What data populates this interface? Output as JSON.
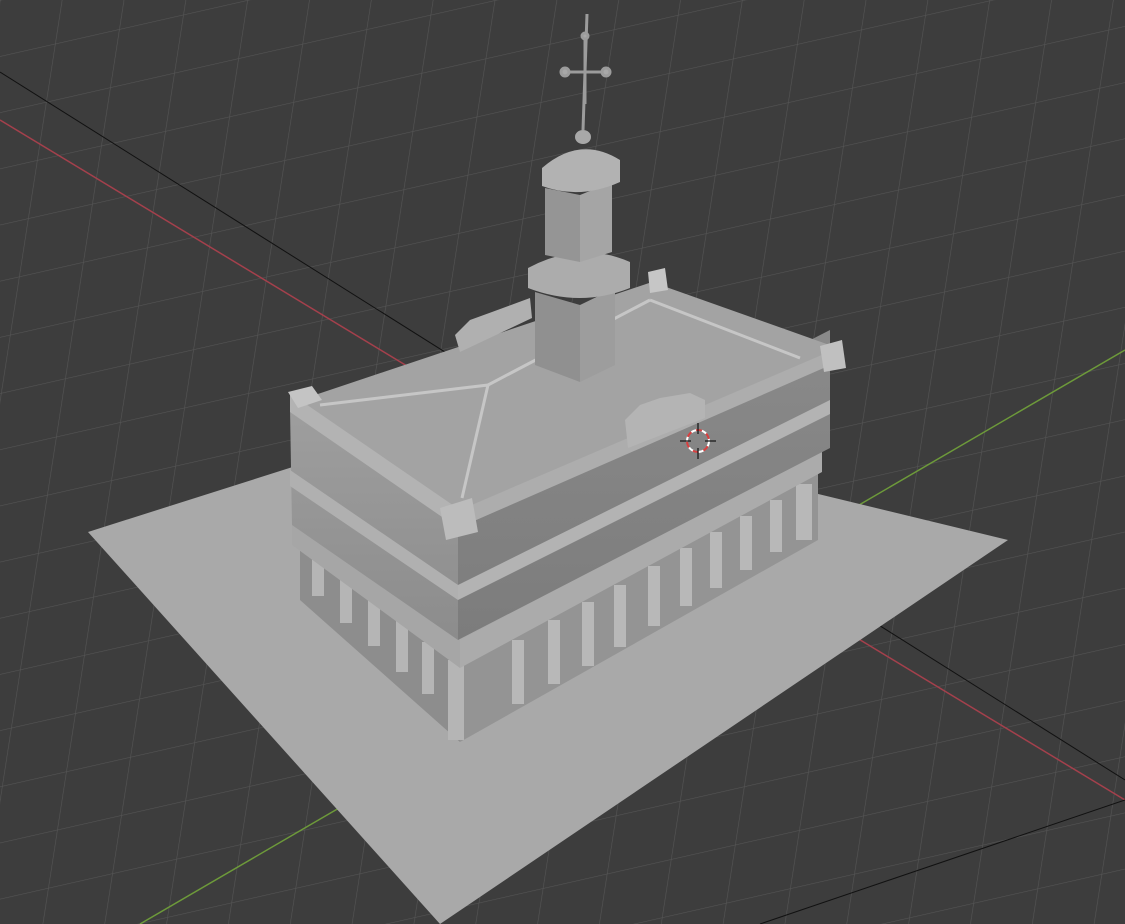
{
  "viewport": {
    "name": "3D Viewport",
    "background": "#3d3d3d",
    "grid_color": "#545454",
    "x_axis_color": "#a4404c",
    "y_axis_color": "#6d9a3a"
  },
  "scene": {
    "objects": [
      {
        "name": "ground-plane",
        "icon": "plane",
        "color": "#a9a9a9"
      },
      {
        "name": "town-hall-building",
        "icon": "mesh",
        "color": "#9c9c9c"
      },
      {
        "name": "bell-tower",
        "icon": "mesh",
        "color": "#a2a2a2"
      },
      {
        "name": "spire-with-cross",
        "icon": "mesh",
        "color": "#9a9a9a"
      }
    ],
    "cursor": {
      "icon": "3d-cursor-icon",
      "colors": [
        "#d94040",
        "#ffffff"
      ]
    }
  }
}
